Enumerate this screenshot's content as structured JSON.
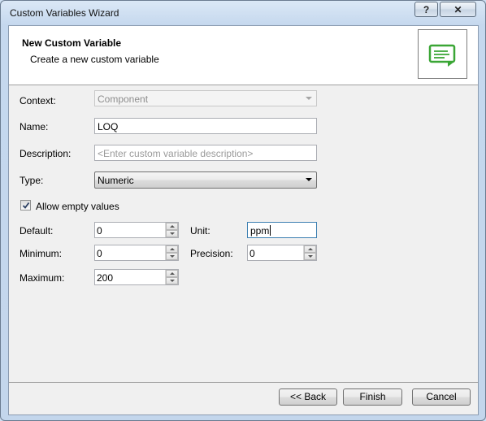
{
  "window": {
    "title": "Custom Variables Wizard"
  },
  "caption_buttons": {
    "help": "?",
    "close": "✕"
  },
  "header": {
    "title": "New Custom Variable",
    "subtitle": "Create a new custom variable",
    "icon": "note-icon",
    "icon_color": "#3aa635"
  },
  "form": {
    "context": {
      "label": "Context:",
      "value": "Component"
    },
    "name": {
      "label": "Name:",
      "value": "LOQ"
    },
    "description": {
      "label": "Description:",
      "placeholder": "<Enter custom variable description>",
      "value": ""
    },
    "type": {
      "label": "Type:",
      "value": "Numeric"
    },
    "allow_empty": {
      "label": "Allow empty values",
      "checked": true
    },
    "default": {
      "label": "Default:",
      "value": "0"
    },
    "unit": {
      "label": "Unit:",
      "value": "ppm"
    },
    "minimum": {
      "label": "Minimum:",
      "value": "0"
    },
    "precision": {
      "label": "Precision:",
      "value": "0"
    },
    "maximum": {
      "label": "Maximum:",
      "value": "200"
    }
  },
  "buttons": {
    "back": "<< Back",
    "finish": "Finish",
    "cancel": "Cancel"
  }
}
